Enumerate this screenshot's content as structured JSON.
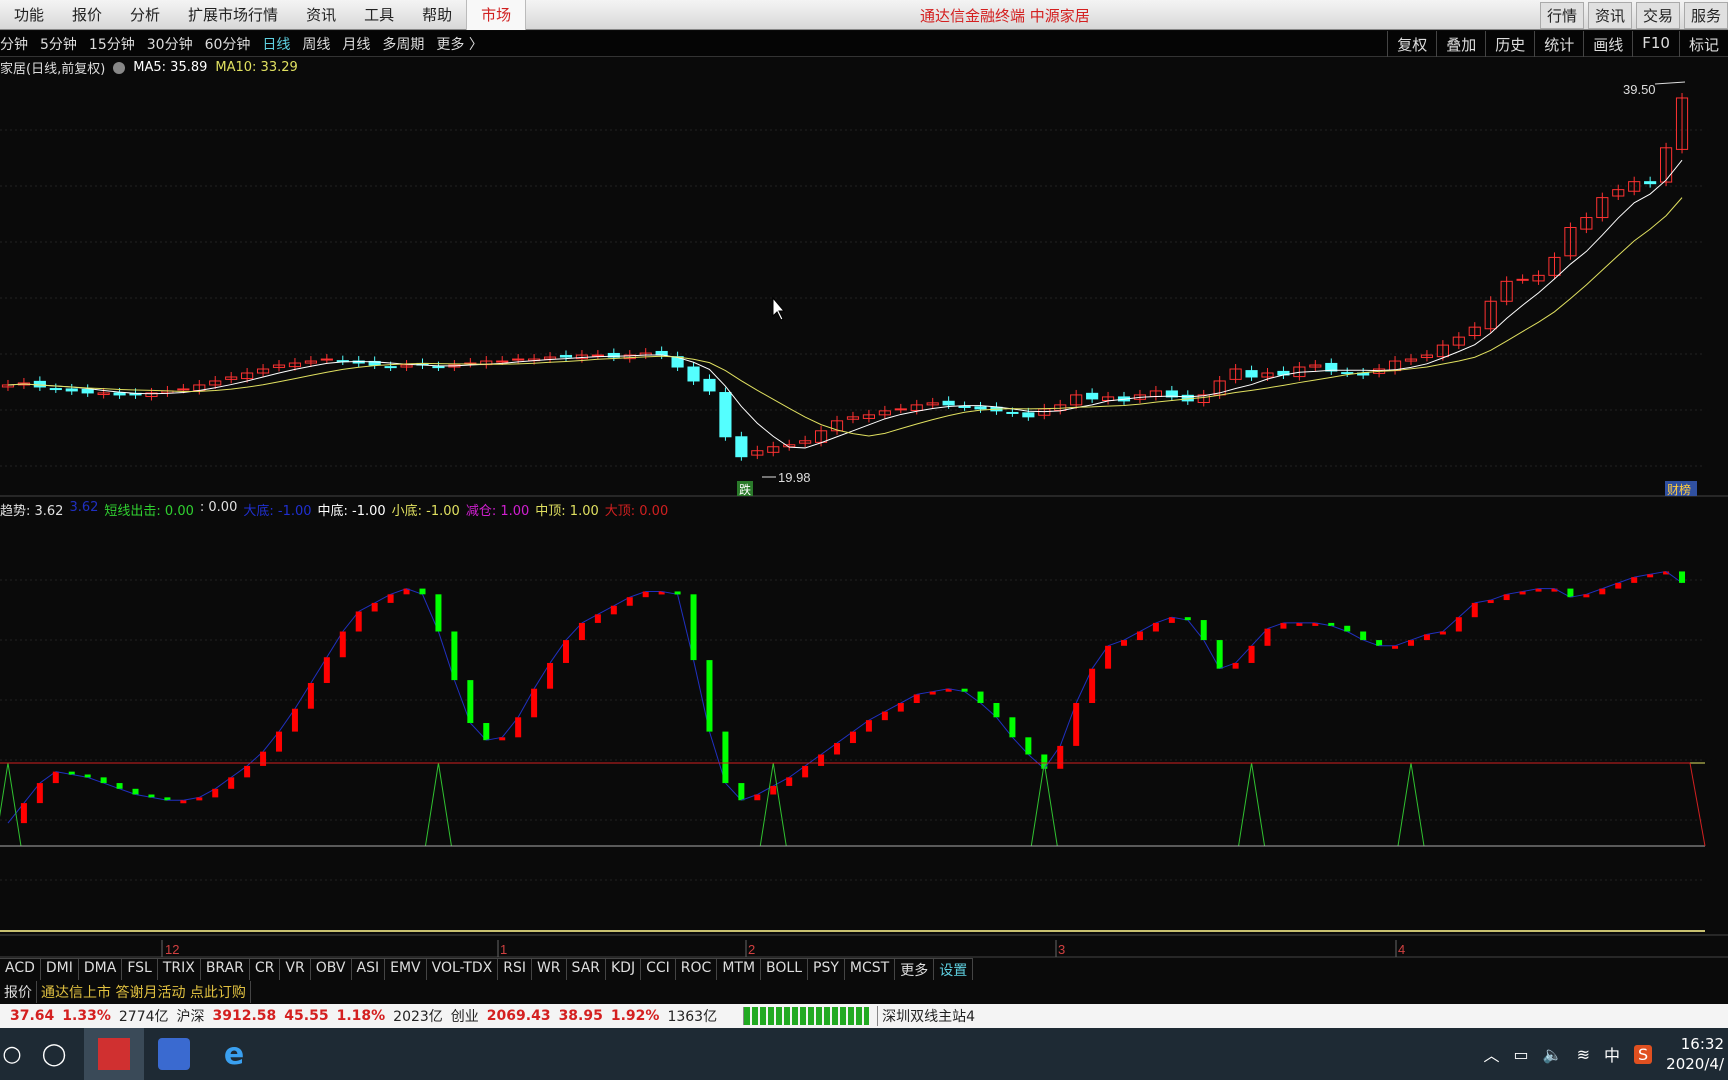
{
  "menu": {
    "items": [
      "功能",
      "报价",
      "分析",
      "扩展市场行情",
      "资讯",
      "工具",
      "帮助"
    ],
    "market": "市场",
    "app_title": "通达信金融终端  中源家居",
    "right_buttons": [
      "行情",
      "资讯",
      "交易",
      "服务"
    ]
  },
  "periods": {
    "items": [
      "分钟",
      "5分钟",
      "15分钟",
      "30分钟",
      "60分钟",
      "日线",
      "周线",
      "月线",
      "多周期",
      "更多 〉"
    ],
    "active": "日线"
  },
  "tools": [
    "复权",
    "叠加",
    "历史",
    "统计",
    "画线",
    "F10",
    "标记"
  ],
  "title_line": {
    "name": "家居(日线,前复权)",
    "ma5": "MA5: 35.89",
    "ma10": "MA10: 33.29"
  },
  "price_labels": {
    "high": "39.50",
    "low": "19.98",
    "down_tag": "跌",
    "fin_tag": "财榜"
  },
  "indicator_label": [
    {
      "text": "趋势: 3.62",
      "color": "#e0e0e0"
    },
    {
      "text": "3.62",
      "color": "#2030c0"
    },
    {
      "text": "短线出击: 0.00",
      "color": "#30d030"
    },
    {
      "text": ": 0.00",
      "color": "#e0e0e0"
    },
    {
      "text": "大底: -1.00",
      "color": "#2030d0"
    },
    {
      "text": "中底: -1.00",
      "color": "#ffffff"
    },
    {
      "text": "小底: -1.00",
      "color": "#e0e060"
    },
    {
      "text": "减仓: 1.00",
      "color": "#d020d0"
    },
    {
      "text": "中顶: 1.00",
      "color": "#e0e060"
    },
    {
      "text": "大顶: 0.00",
      "color": "#d02020"
    }
  ],
  "date_axis": [
    "12",
    "1",
    "2",
    "3",
    "4"
  ],
  "indicator_tabs": [
    "ACD",
    "DMI",
    "DMA",
    "FSL",
    "TRIX",
    "BRAR",
    "CR",
    "VR",
    "OBV",
    "ASI",
    "EMV",
    "VOL-TDX",
    "RSI",
    "WR",
    "SAR",
    "KDJ",
    "CCI",
    "ROC",
    "MTM",
    "BOLL",
    "PSY",
    "MCST",
    "更多",
    "设置"
  ],
  "news": [
    "报价",
    "通达信上市 答谢月活动 点此订购"
  ],
  "index_bar": {
    "a_val": "37.64",
    "a_pct": "1.33%",
    "a_amt": "2774亿",
    "hs_label": "沪深",
    "hs_val": "3912.58",
    "hs_chg": "45.55",
    "hs_pct": "1.18%",
    "hs_amt": "2023亿",
    "cy_label": "创业",
    "cy_val": "2069.43",
    "cy_chg": "38.95",
    "cy_pct": "1.92%",
    "cy_amt": "1363亿",
    "server": "深圳双线主站4"
  },
  "tray": {
    "ime": "中",
    "time": "16:32",
    "date": "2020/4/"
  },
  "colors": {
    "up": "#ff3232",
    "down": "#54ffff",
    "ma5": "#ffffff",
    "ma10": "#e0e060",
    "ind_up": "#ff0000",
    "ind_down": "#00ff00"
  },
  "chart_data": {
    "type": "candlestick",
    "closes": [
      24.6,
      24.7,
      24.5,
      24.4,
      24.3,
      24.2,
      24.2,
      24.1,
      24.1,
      24.2,
      24.3,
      24.4,
      24.6,
      24.8,
      25.0,
      25.2,
      25.4,
      25.6,
      25.7,
      25.8,
      25.9,
      25.8,
      25.7,
      25.6,
      25.5,
      25.6,
      25.6,
      25.5,
      25.6,
      25.7,
      25.8,
      25.8,
      25.9,
      25.9,
      26.0,
      26.0,
      26.1,
      26.1,
      26.0,
      26.1,
      26.2,
      26.1,
      25.5,
      24.8,
      24.3,
      22.0,
      21.0,
      21.3,
      21.5,
      21.6,
      21.8,
      22.3,
      22.8,
      23.0,
      23.1,
      23.3,
      23.4,
      23.6,
      23.7,
      23.6,
      23.5,
      23.4,
      23.3,
      23.2,
      23.0,
      23.4,
      23.6,
      24.1,
      23.9,
      24.0,
      23.8,
      24.1,
      24.3,
      24.0,
      23.8,
      24.1,
      24.8,
      25.4,
      25.0,
      25.2,
      25.1,
      25.5,
      25.6,
      25.3,
      25.2,
      25.1,
      25.4,
      25.8,
      25.9,
      26.1,
      26.6,
      27.0,
      27.5,
      28.8,
      29.8,
      29.9,
      30.1,
      31.0,
      32.5,
      33.0,
      34.0,
      34.4,
      34.8,
      34.7,
      36.5,
      39.0
    ],
    "indicator": [
      8,
      15,
      22,
      26,
      25,
      24,
      22,
      20,
      18,
      17,
      16,
      16,
      17,
      20,
      24,
      28,
      33,
      40,
      48,
      57,
      66,
      75,
      82,
      85,
      88,
      90,
      88,
      75,
      58,
      43,
      37,
      38,
      45,
      55,
      64,
      72,
      78,
      81,
      84,
      87,
      89,
      89,
      88,
      65,
      40,
      22,
      16,
      18,
      21,
      24,
      28,
      32,
      36,
      40,
      44,
      47,
      50,
      53,
      54,
      55,
      54,
      50,
      45,
      38,
      32,
      27,
      35,
      50,
      62,
      70,
      72,
      75,
      78,
      80,
      79,
      72,
      62,
      64,
      70,
      76,
      78,
      78,
      78,
      77,
      75,
      72,
      70,
      70,
      72,
      74,
      75,
      80,
      85,
      86,
      88,
      89,
      90,
      90,
      87,
      88,
      90,
      92,
      94,
      95,
      96,
      92
    ],
    "signal_bars": [
      0,
      27,
      48,
      65,
      78,
      88
    ]
  }
}
